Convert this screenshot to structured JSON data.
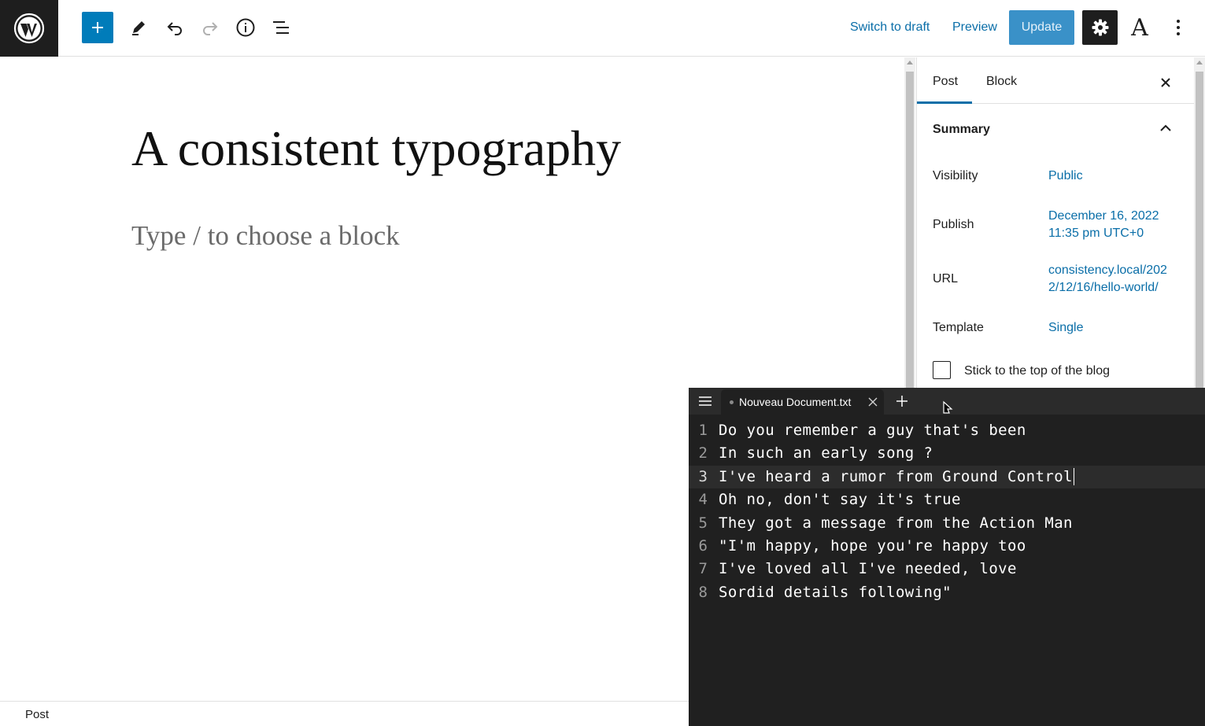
{
  "toolbar": {
    "switch_to_draft": "Switch to draft",
    "preview": "Preview",
    "update": "Update",
    "font_button": "A",
    "accent_color": "#007cba"
  },
  "editor": {
    "title": "A consistent typography",
    "block_placeholder": "Type / to choose a block"
  },
  "sidebar": {
    "tabs": [
      {
        "label": "Post",
        "active": true
      },
      {
        "label": "Block",
        "active": false
      }
    ],
    "summary_title": "Summary",
    "rows": [
      {
        "label": "Visibility",
        "value": "Public"
      },
      {
        "label": "Publish",
        "value": "December 16, 2022 11:35 pm UTC+0"
      },
      {
        "label": "URL",
        "value": "consistency.local/2022/12/16/hello-world/"
      },
      {
        "label": "Template",
        "value": "Single"
      }
    ],
    "sticky_label": "Stick to the top of the blog",
    "sticky_checked": false
  },
  "status_bar": {
    "breadcrumb": "Post"
  },
  "notepad": {
    "tab_title": "Nouveau Document.txt",
    "current_line": 3,
    "lines": [
      "Do you remember a guy that's been",
      "In such an early song ?",
      "I've heard a rumor from Ground Control",
      "Oh no, don't say it's true",
      "They got a message from the Action Man",
      "\"I'm happy, hope you're happy too",
      "I've loved all I've needed, love",
      "Sordid details following\""
    ]
  }
}
